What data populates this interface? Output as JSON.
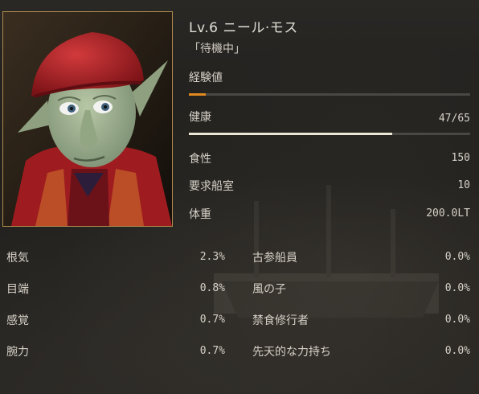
{
  "character": {
    "name": "Lv.6 ニール·モス",
    "status": "「待機中」"
  },
  "exp": {
    "label": "経験値",
    "fraction": 0.06,
    "color": "#e08a1e"
  },
  "health": {
    "label": "健康",
    "value": "47/65",
    "fraction": 0.723,
    "color": "#ece6d4"
  },
  "stats": [
    {
      "label": "食性",
      "value": "150"
    },
    {
      "label": "要求船室",
      "value": "10"
    },
    {
      "label": "体重",
      "value": "200.0LT"
    }
  ],
  "skills_left": [
    {
      "label": "根気",
      "value": "2.3%"
    },
    {
      "label": "目端",
      "value": "0.8%"
    },
    {
      "label": "感覚",
      "value": "0.7%"
    },
    {
      "label": "腕力",
      "value": "0.7%"
    }
  ],
  "skills_right": [
    {
      "label": "古参船員",
      "value": "0.0%"
    },
    {
      "label": "風の子",
      "value": "0.0%"
    },
    {
      "label": "禁食修行者",
      "value": "0.0%"
    },
    {
      "label": "先天的な力持ち",
      "value": "0.0%"
    }
  ]
}
